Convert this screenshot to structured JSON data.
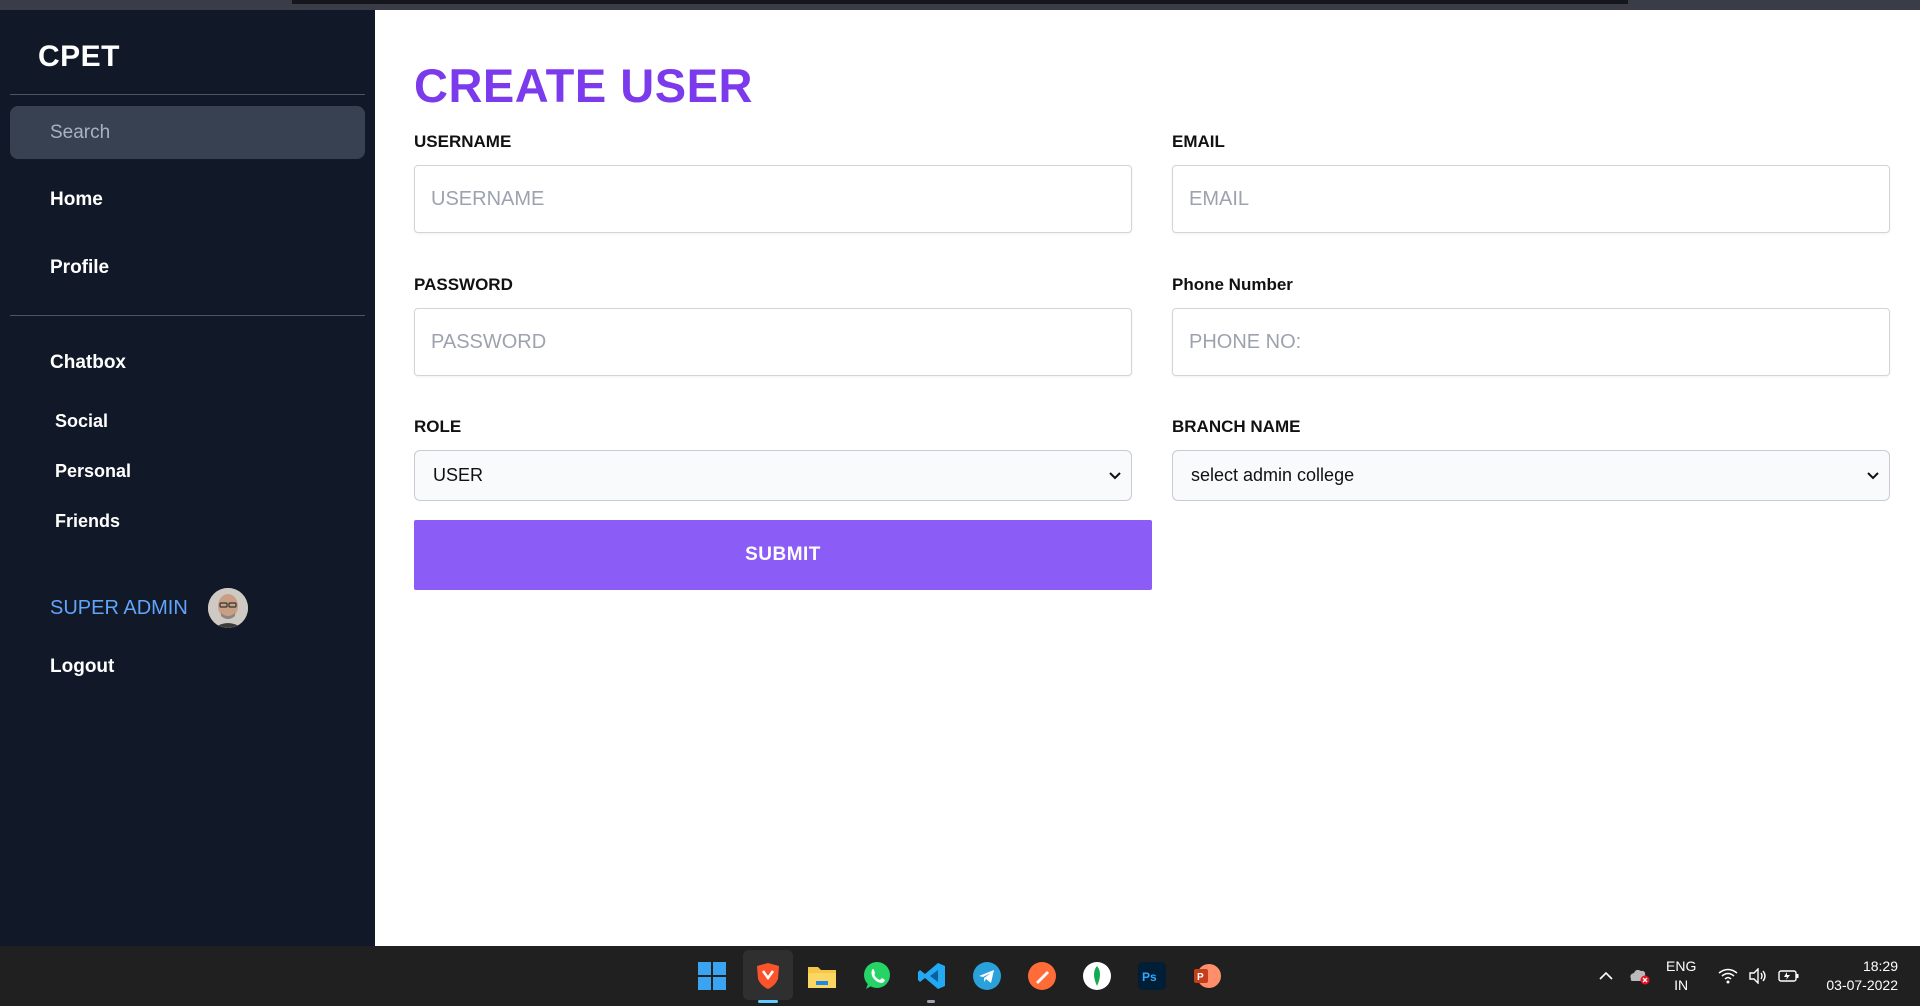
{
  "sidebar": {
    "brand": "CPET",
    "search_placeholder": "Search",
    "nav": {
      "home": "Home",
      "profile": "Profile",
      "chatbox": "Chatbox"
    },
    "chat_items": [
      "Social",
      "Personal",
      "Friends"
    ],
    "user_label": "SUPER ADMIN",
    "logout": "Logout"
  },
  "form": {
    "title": "CREATE USER",
    "username_label": "USERNAME",
    "username_placeholder": "USERNAME",
    "email_label": "EMAIL",
    "email_placeholder": "EMAIL",
    "password_label": "PASSWORD",
    "password_placeholder": "PASSWORD",
    "phone_label": "Phone Number",
    "phone_placeholder": "PHONE NO:",
    "role_label": "ROLE",
    "role_value": "USER",
    "branch_label": "BRANCH NAME",
    "branch_value": "select admin college",
    "submit_label": "SUBMIT"
  },
  "taskbar": {
    "apps": [
      "windows-start",
      "brave",
      "file-explorer",
      "whatsapp",
      "vscode",
      "telegram",
      "postman",
      "mongodb-compass",
      "photoshop",
      "powerpoint"
    ],
    "photoshop_text": "Ps",
    "powerpoint_text": "P",
    "lang_line1": "ENG",
    "lang_line2": "IN",
    "time": "18:29",
    "date": "03-07-2022"
  },
  "colors": {
    "sidebar_bg": "#111827",
    "accent": "#7c3aed",
    "button": "#8b5cf6",
    "admin_link": "#60a5fa"
  }
}
